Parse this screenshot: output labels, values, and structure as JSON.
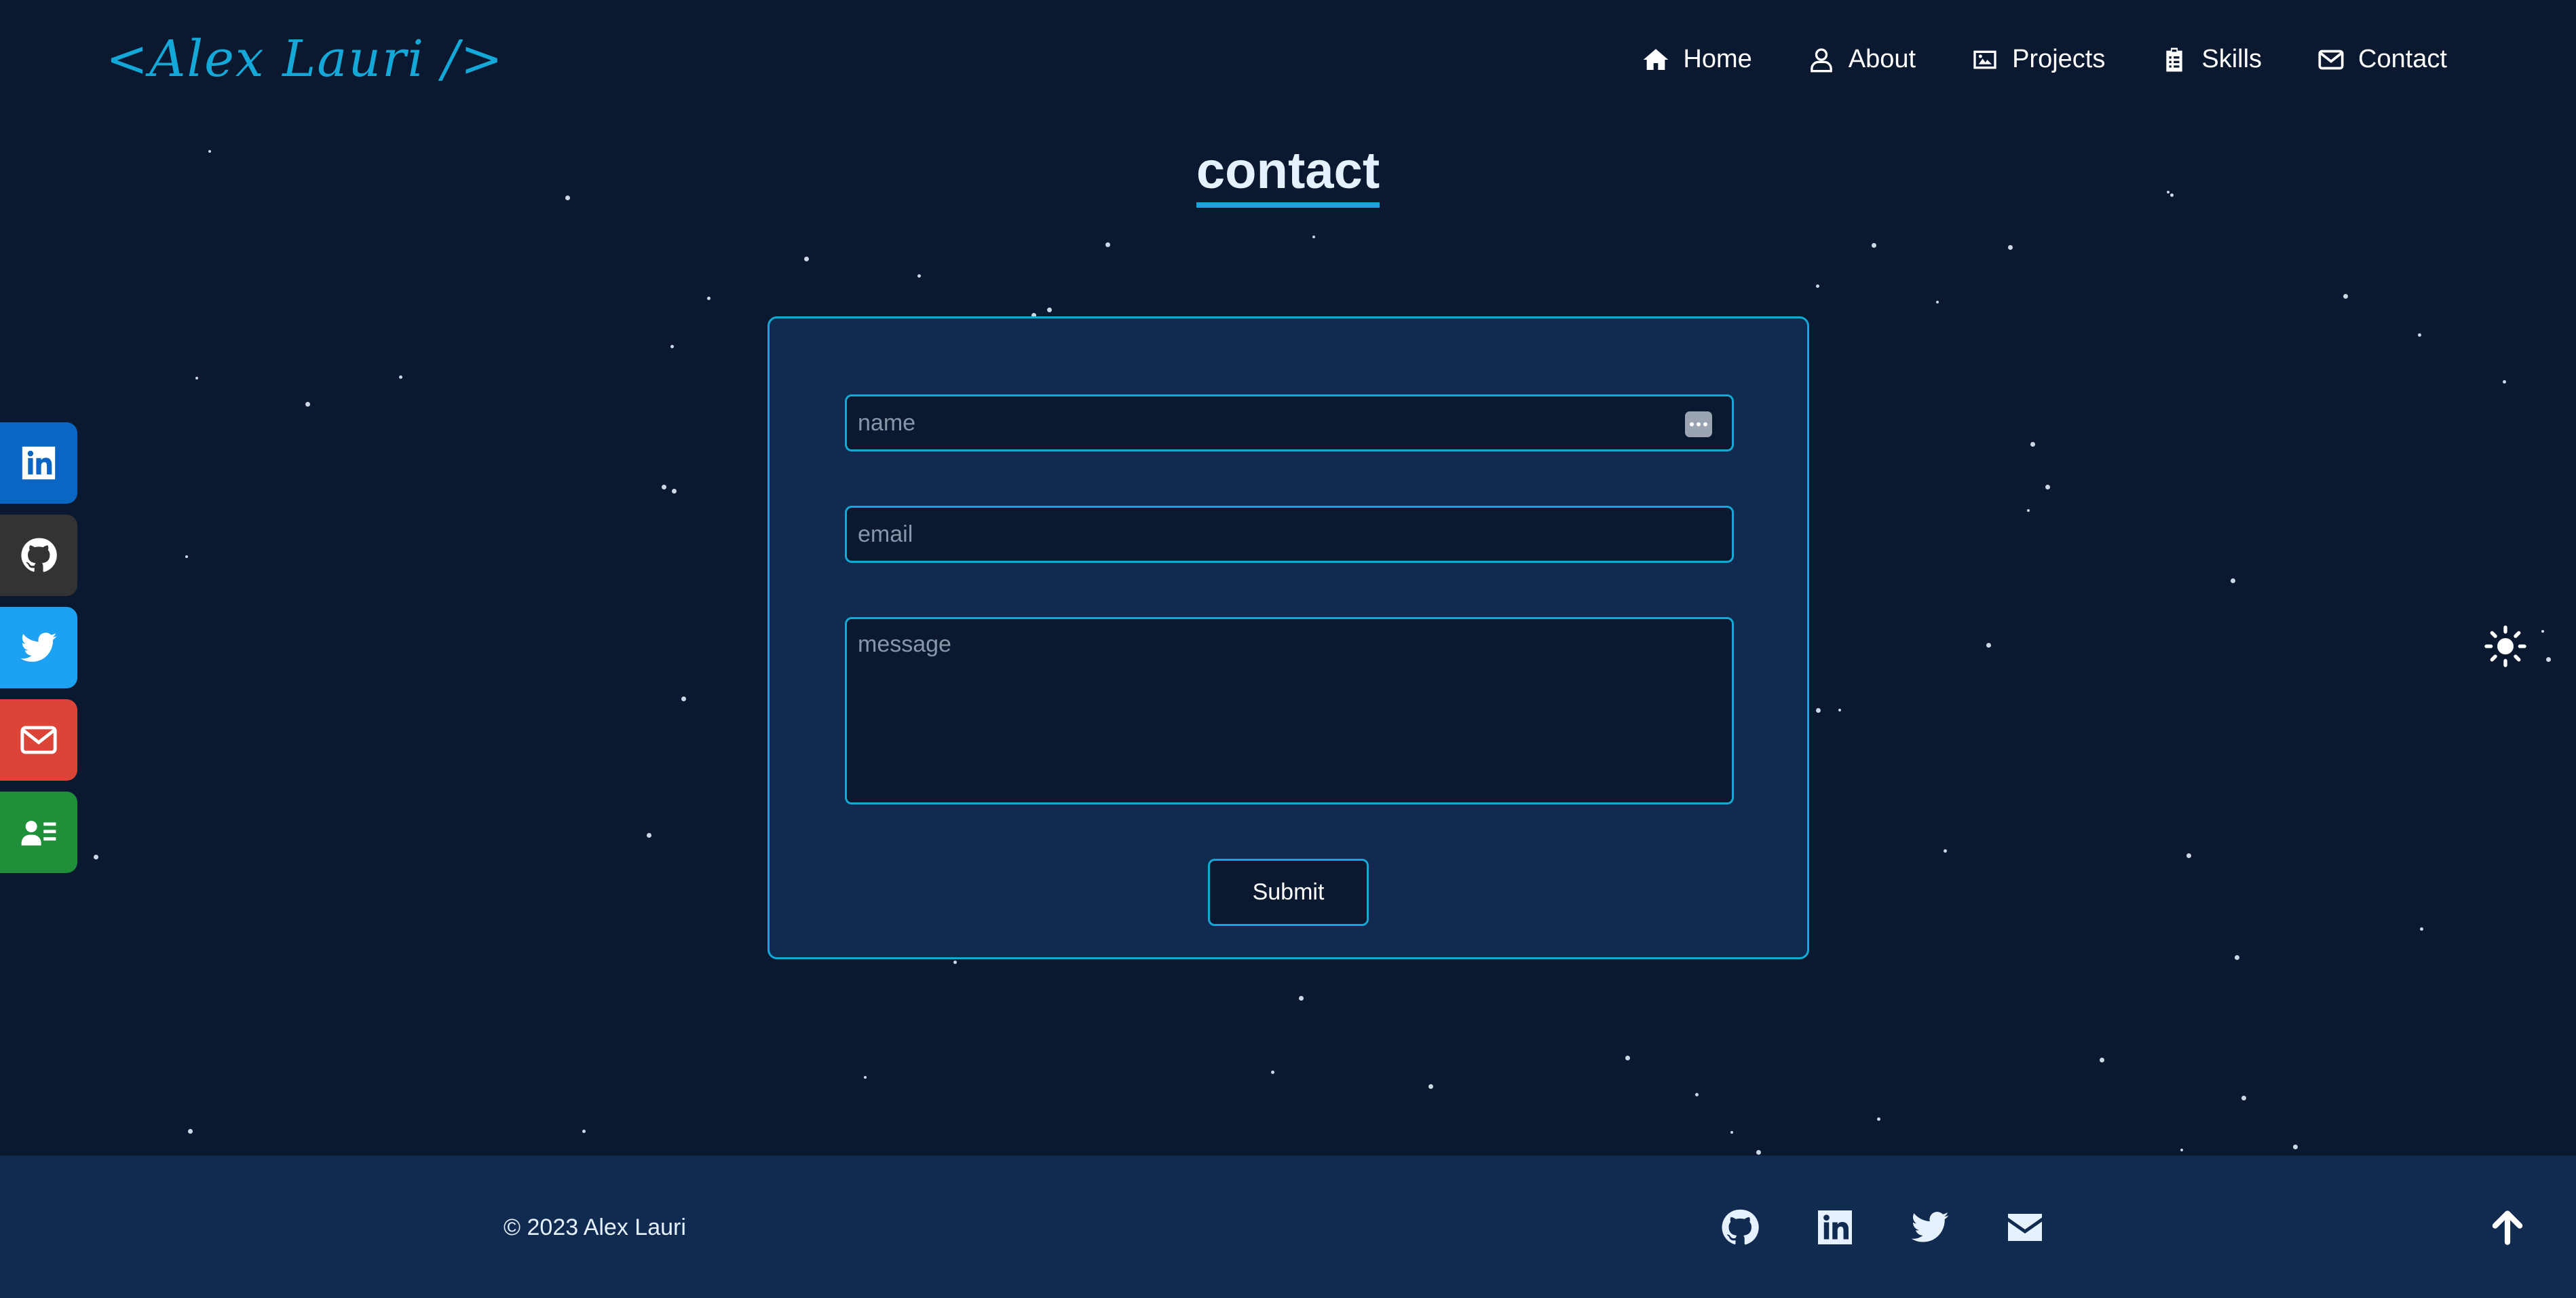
{
  "brand": {
    "logo_text": "<Alex Lauri />",
    "accent_color": "#13a8d8",
    "background_color": "#0a192f",
    "panel_color": "#112a50"
  },
  "nav": {
    "items": [
      {
        "label": "Home",
        "icon": "home-icon"
      },
      {
        "label": "About",
        "icon": "user-icon"
      },
      {
        "label": "Projects",
        "icon": "image-icon"
      },
      {
        "label": "Skills",
        "icon": "clipboard-icon"
      },
      {
        "label": "Contact",
        "icon": "envelope-icon"
      }
    ]
  },
  "page": {
    "title": "contact"
  },
  "social_sidebar": [
    {
      "name": "linkedin",
      "icon": "linkedin-icon",
      "color": "#0a66c2"
    },
    {
      "name": "github",
      "icon": "github-icon",
      "color": "#333333"
    },
    {
      "name": "twitter",
      "icon": "twitter-icon",
      "color": "#1da1f2"
    },
    {
      "name": "email",
      "icon": "envelope-icon",
      "color": "#db4437"
    },
    {
      "name": "resume",
      "icon": "id-card-icon",
      "color": "#1f8f3a"
    }
  ],
  "theme_toggle": {
    "icon": "sun-icon"
  },
  "form": {
    "name_placeholder": "name",
    "name_value": "",
    "email_placeholder": "email",
    "email_value": "",
    "message_placeholder": "message",
    "message_value": "",
    "submit_label": "Submit"
  },
  "footer": {
    "copyright": "© 2023 Alex Lauri",
    "icons": [
      "github-icon",
      "linkedin-icon",
      "twitter-icon",
      "envelope-icon"
    ],
    "back_to_top_icon": "arrow-up-icon"
  }
}
